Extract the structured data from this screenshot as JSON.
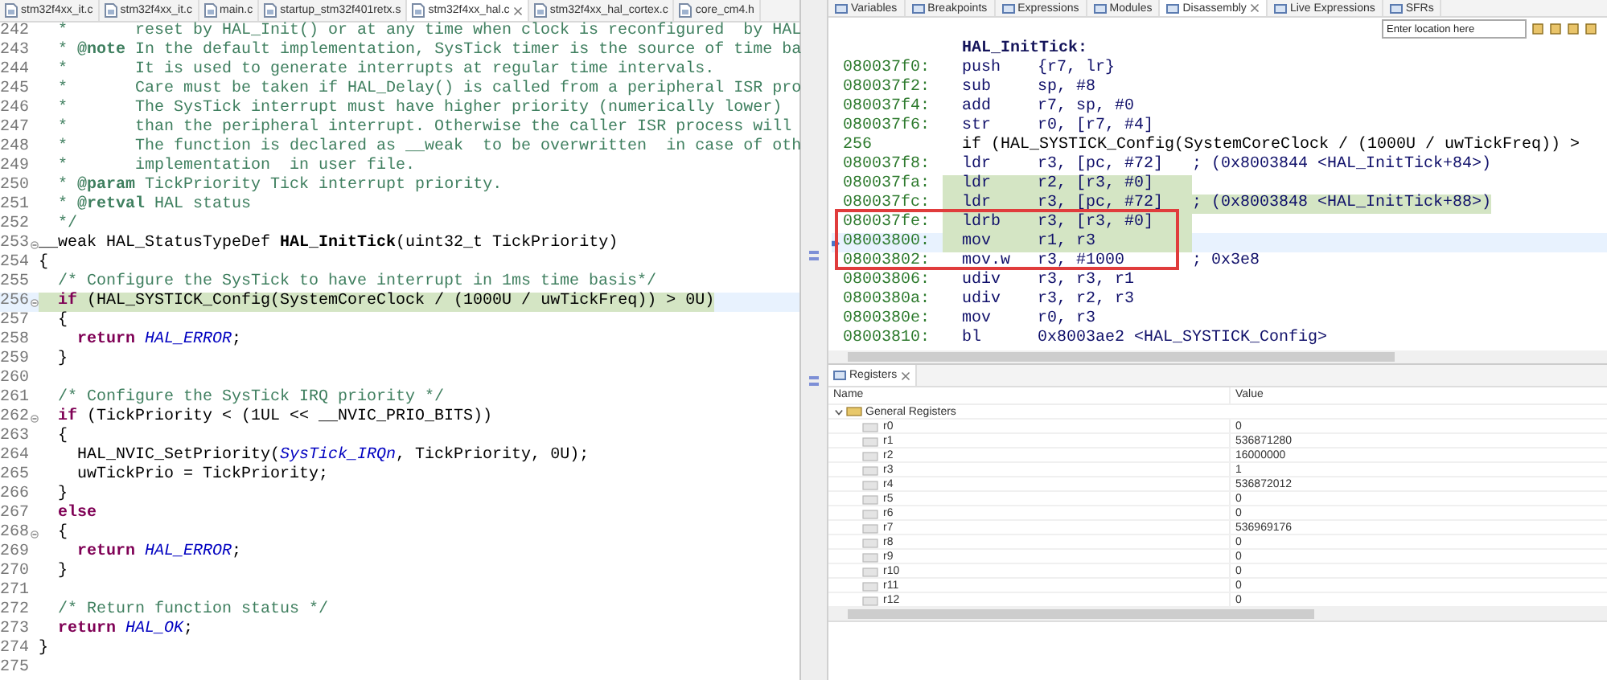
{
  "editor": {
    "tabs": [
      {
        "label": "stm32f4xx_it.c",
        "selected": false
      },
      {
        "label": "stm32f4xx_it.c",
        "selected": false
      },
      {
        "label": "main.c",
        "selected": false
      },
      {
        "label": "startup_stm32f401retx.s",
        "selected": false
      },
      {
        "label": "stm32f4xx_hal.c",
        "selected": true
      },
      {
        "label": "stm32f4xx_hal_cortex.c",
        "selected": false
      },
      {
        "label": "core_cm4.h",
        "selected": false
      }
    ],
    "lines": [
      {
        "number": "242",
        "foldable": false,
        "highlighted": false,
        "segments": [
          {
            "text": "  *       reset by HAL_Init() or at any time when clock is reconfigured  by HAL",
            "kind": "comment"
          }
        ]
      },
      {
        "number": "243",
        "foldable": false,
        "highlighted": false,
        "segments": [
          {
            "text": "  * ",
            "kind": "comment"
          },
          {
            "text": "@note",
            "kind": "doctag"
          },
          {
            "text": " In the default implementation, SysTick timer is the source of time ba",
            "kind": "comment"
          }
        ]
      },
      {
        "number": "244",
        "foldable": false,
        "highlighted": false,
        "segments": [
          {
            "text": "  *       It is used to generate interrupts at regular time intervals.",
            "kind": "comment"
          }
        ]
      },
      {
        "number": "245",
        "foldable": false,
        "highlighted": false,
        "segments": [
          {
            "text": "  *       Care must be taken if HAL_Delay() is called from a peripheral ISR pro",
            "kind": "comment"
          }
        ]
      },
      {
        "number": "246",
        "foldable": false,
        "highlighted": false,
        "segments": [
          {
            "text": "  *       The SysTick interrupt must have higher priority (numerically lower)",
            "kind": "comment"
          }
        ]
      },
      {
        "number": "247",
        "foldable": false,
        "highlighted": false,
        "segments": [
          {
            "text": "  *       than the peripheral interrupt. Otherwise the caller ISR process will",
            "kind": "comment"
          }
        ]
      },
      {
        "number": "248",
        "foldable": false,
        "highlighted": false,
        "segments": [
          {
            "text": "  *       The function is declared as __weak  to be overwritten  in case of oth",
            "kind": "comment"
          }
        ]
      },
      {
        "number": "249",
        "foldable": false,
        "highlighted": false,
        "segments": [
          {
            "text": "  *       implementation  in user file.",
            "kind": "comment"
          }
        ]
      },
      {
        "number": "250",
        "foldable": false,
        "highlighted": false,
        "segments": [
          {
            "text": "  * ",
            "kind": "comment"
          },
          {
            "text": "@param",
            "kind": "doctag"
          },
          {
            "text": " TickPriority Tick interrupt priority.",
            "kind": "comment"
          }
        ]
      },
      {
        "number": "251",
        "foldable": false,
        "highlighted": false,
        "segments": [
          {
            "text": "  * ",
            "kind": "comment"
          },
          {
            "text": "@retval",
            "kind": "doctag"
          },
          {
            "text": " HAL status",
            "kind": "comment"
          }
        ]
      },
      {
        "number": "252",
        "foldable": false,
        "highlighted": false,
        "segments": [
          {
            "text": "  */",
            "kind": "comment"
          }
        ]
      },
      {
        "number": "253",
        "foldable": true,
        "highlighted": false,
        "segments": [
          {
            "text": "__weak HAL_StatusTypeDef ",
            "kind": "plain"
          },
          {
            "text": "HAL_InitTick",
            "kind": "bold"
          },
          {
            "text": "(uint32_t TickPriority)",
            "kind": "plain"
          }
        ]
      },
      {
        "number": "254",
        "foldable": false,
        "highlighted": false,
        "segments": [
          {
            "text": "{",
            "kind": "plain"
          }
        ]
      },
      {
        "number": "255",
        "foldable": false,
        "highlighted": false,
        "segments": [
          {
            "text": "  /* Configure the SysTick to have interrupt in 1ms time basis*/",
            "kind": "comment"
          }
        ]
      },
      {
        "number": "256",
        "foldable": true,
        "highlighted": true,
        "segments": [
          {
            "text": "  if",
            "kind": "keyword"
          },
          {
            "text": " (HAL_SYSTICK_Config(SystemCoreClock / (1000U / uwTickFreq)) > 0U)",
            "kind": "plain"
          }
        ]
      },
      {
        "number": "257",
        "foldable": false,
        "highlighted": false,
        "segments": [
          {
            "text": "  {",
            "kind": "plain"
          }
        ]
      },
      {
        "number": "258",
        "foldable": false,
        "highlighted": false,
        "segments": [
          {
            "text": "    return ",
            "kind": "keyword"
          },
          {
            "text": "HAL_ERROR",
            "kind": "macro"
          },
          {
            "text": ";",
            "kind": "plain"
          }
        ]
      },
      {
        "number": "259",
        "foldable": false,
        "highlighted": false,
        "segments": [
          {
            "text": "  }",
            "kind": "plain"
          }
        ]
      },
      {
        "number": "260",
        "foldable": false,
        "highlighted": false
      },
      {
        "number": "261",
        "foldable": false,
        "highlighted": false,
        "segments": [
          {
            "text": "  /* Configure the SysTick IRQ priority */",
            "kind": "comment"
          }
        ]
      },
      {
        "number": "262",
        "foldable": true,
        "highlighted": false,
        "segments": [
          {
            "text": "  if",
            "kind": "keyword"
          },
          {
            "text": " (TickPriority < (1UL << __NVIC_PRIO_BITS))",
            "kind": "plain"
          }
        ]
      },
      {
        "number": "263",
        "foldable": false,
        "highlighted": false,
        "segments": [
          {
            "text": "  {",
            "kind": "plain"
          }
        ]
      },
      {
        "number": "264",
        "foldable": false,
        "highlighted": false,
        "segments": [
          {
            "text": "    HAL_NVIC_SetPriority(",
            "kind": "plain"
          },
          {
            "text": "SysTick_IRQn",
            "kind": "macro"
          },
          {
            "text": ", TickPriority, 0U);",
            "kind": "plain"
          }
        ]
      },
      {
        "number": "265",
        "foldable": false,
        "highlighted": false,
        "segments": [
          {
            "text": "    uwTickPrio = TickPriority;",
            "kind": "plain"
          }
        ]
      },
      {
        "number": "266",
        "foldable": false,
        "highlighted": false,
        "segments": [
          {
            "text": "  }",
            "kind": "plain"
          }
        ]
      },
      {
        "number": "267",
        "foldable": false,
        "highlighted": false,
        "segments": [
          {
            "text": "  else",
            "kind": "keyword"
          }
        ]
      },
      {
        "number": "268",
        "foldable": true,
        "highlighted": false,
        "segments": [
          {
            "text": "  {",
            "kind": "plain"
          }
        ]
      },
      {
        "number": "269",
        "foldable": false,
        "highlighted": false,
        "segments": [
          {
            "text": "    return ",
            "kind": "keyword"
          },
          {
            "text": "HAL_ERROR",
            "kind": "macro"
          },
          {
            "text": ";",
            "kind": "plain"
          }
        ]
      },
      {
        "number": "270",
        "foldable": false,
        "highlighted": false,
        "segments": [
          {
            "text": "  }",
            "kind": "plain"
          }
        ]
      },
      {
        "number": "271",
        "foldable": false,
        "highlighted": false
      },
      {
        "number": "272",
        "foldable": false,
        "highlighted": false,
        "segments": [
          {
            "text": "  /* Return function status */",
            "kind": "comment"
          }
        ]
      },
      {
        "number": "273",
        "foldable": false,
        "highlighted": false,
        "segments": [
          {
            "text": "  return ",
            "kind": "keyword"
          },
          {
            "text": "HAL_OK",
            "kind": "macro"
          },
          {
            "text": ";",
            "kind": "plain"
          }
        ]
      },
      {
        "number": "274",
        "foldable": false,
        "highlighted": false,
        "segments": [
          {
            "text": "}",
            "kind": "plain"
          }
        ]
      },
      {
        "number": "275",
        "foldable": false,
        "highlighted": false
      }
    ]
  },
  "debug_tabs": [
    {
      "label": "Variables",
      "selected": false
    },
    {
      "label": "Breakpoints",
      "selected": false
    },
    {
      "label": "Expressions",
      "selected": false
    },
    {
      "label": "Modules",
      "selected": false
    },
    {
      "label": "Disassembly",
      "selected": true
    },
    {
      "label": "Live Expressions",
      "selected": false
    },
    {
      "label": "SFRs",
      "selected": false
    }
  ],
  "disassembly": {
    "location": {
      "placeholder": "Enter location here"
    },
    "rows": [
      {
        "kind": "label",
        "text": "HAL_InitTick:"
      },
      {
        "kind": "instruction",
        "address": "080037f0:",
        "mnemonic": "push",
        "operands": "{r7, lr}",
        "executed": false,
        "current": false,
        "boxed": false
      },
      {
        "kind": "instruction",
        "address": "080037f2:",
        "mnemonic": "sub",
        "operands": "sp, #8",
        "executed": false,
        "current": false,
        "boxed": false
      },
      {
        "kind": "instruction",
        "address": "080037f4:",
        "mnemonic": "add",
        "operands": "r7, sp, #0",
        "executed": false,
        "current": false,
        "boxed": false
      },
      {
        "kind": "instruction",
        "address": "080037f6:",
        "mnemonic": "str",
        "operands": "r0, [r7, #4]",
        "executed": false,
        "current": false,
        "boxed": false
      },
      {
        "kind": "source",
        "line": "256",
        "text": "if (HAL_SYSTICK_Config(SystemCoreClock / (1000U / uwTickFreq)) >"
      },
      {
        "kind": "instruction",
        "address": "080037f8:",
        "mnemonic": "ldr",
        "operands": "r3, [pc, #72]",
        "note": "; (0x8003844 <HAL_InitTick+84>)",
        "executed": false,
        "current": false,
        "boxed": false
      },
      {
        "kind": "instruction",
        "address": "080037fa:",
        "mnemonic": "ldr",
        "operands": "r2, [r3, #0]",
        "executed": true,
        "current": false,
        "boxed": false
      },
      {
        "kind": "instruction",
        "address": "080037fc:",
        "mnemonic": "ldr",
        "operands": "r3, [pc, #72]",
        "note": "; (0x8003848 <HAL_InitTick+88>)",
        "executed": true,
        "current": false,
        "boxed": false
      },
      {
        "kind": "instruction",
        "address": "080037fe:",
        "mnemonic": "ldrb",
        "operands": "r3, [r3, #0]",
        "executed": true,
        "current": false,
        "boxed": true
      },
      {
        "kind": "instruction",
        "address": "08003800:",
        "mnemonic": "mov",
        "operands": "r1, r3",
        "executed": true,
        "current": true,
        "boxed": true
      },
      {
        "kind": "instruction",
        "address": "08003802:",
        "mnemonic": "mov.w",
        "operands": "r3, #1000",
        "note": "; 0x3e8",
        "executed": false,
        "current": false,
        "boxed": true
      },
      {
        "kind": "instruction",
        "address": "08003806:",
        "mnemonic": "udiv",
        "operands": "r3, r3, r1",
        "executed": false,
        "current": false,
        "boxed": false
      },
      {
        "kind": "instruction",
        "address": "0800380a:",
        "mnemonic": "udiv",
        "operands": "r3, r2, r3",
        "executed": false,
        "current": false,
        "boxed": false
      },
      {
        "kind": "instruction",
        "address": "0800380e:",
        "mnemonic": "mov",
        "operands": "r0, r3",
        "executed": false,
        "current": false,
        "boxed": false
      },
      {
        "kind": "instruction",
        "address": "08003810:",
        "mnemonic": "bl",
        "operands": "0x8003ae2 <HAL_SYSTICK_Config>",
        "executed": false,
        "current": false,
        "boxed": false
      }
    ]
  },
  "registers": {
    "tab": {
      "label": "Registers",
      "selected": true
    },
    "columns": [
      "Name",
      "Value"
    ],
    "groups": [
      {
        "name": "General Registers",
        "expanded": true,
        "children": [
          {
            "name": "r0",
            "value": "0"
          },
          {
            "name": "r1",
            "value": "536871280"
          },
          {
            "name": "r2",
            "value": "16000000"
          },
          {
            "name": "r3",
            "value": "1"
          },
          {
            "name": "r4",
            "value": "536872012"
          },
          {
            "name": "r5",
            "value": "0"
          },
          {
            "name": "r6",
            "value": "0"
          },
          {
            "name": "r7",
            "value": "536969176"
          },
          {
            "name": "r8",
            "value": "0"
          },
          {
            "name": "r9",
            "value": "0"
          },
          {
            "name": "r10",
            "value": "0"
          },
          {
            "name": "r11",
            "value": "0"
          },
          {
            "name": "r12",
            "value": "0"
          }
        ]
      }
    ]
  }
}
